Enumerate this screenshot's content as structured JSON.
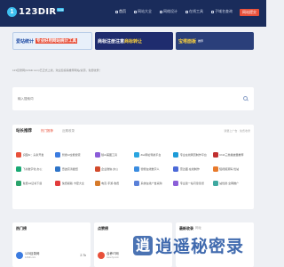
{
  "header": {
    "logo_mark": "1",
    "logo_text": "123DIR",
    "logo_sup": "beta",
    "nav": [
      {
        "label": "首页",
        "active": true
      },
      {
        "label": "网站大全",
        "active": false
      },
      {
        "label": "网络设计",
        "active": false
      },
      {
        "label": "在线工具",
        "active": false
      },
      {
        "label": "子域名查询",
        "active": false
      }
    ],
    "submit_label": "网站提交"
  },
  "banners": [
    {
      "text": "爱站统计",
      "highlight": "专业好用网站统计工具"
    },
    {
      "text": "商标注册注意",
      "highlight": "商标转让"
    },
    {
      "text": "宝塔面板",
      "sub": "推荐"
    }
  ],
  "notice": "123目录网(123dir.com)已正式上线，欢迎您投稿推荐网站/资源，免费收录！",
  "search": {
    "placeholder": "输入搜索词"
  },
  "recommend": {
    "title": "站长推荐",
    "tabs": [
      "热门推荐",
      "近期收录"
    ],
    "link": "我要上广告 · 免费收录",
    "items": [
      {
        "label": "识图AI：头条开发",
        "color": "#e8503a"
      },
      {
        "label": "智搜AI全能搜索",
        "color": "#3b7be0"
      },
      {
        "label": "随AI美图工具",
        "color": "#8a5cd8"
      },
      {
        "label": "Ziel网址导航平台",
        "color": "#2aa5e0"
      },
      {
        "label": "专业在线网页制作平台",
        "color": "#1d9bd8"
      },
      {
        "label": "CNA三类播放器推荐",
        "color": "#c03030"
      },
      {
        "label": "飞书数字化·办公",
        "color": "#19a974"
      },
      {
        "label": "奇迹高清壁纸",
        "color": "#2e74c8"
      },
      {
        "label": "企业微信·办公",
        "color": "#d24a2c"
      },
      {
        "label": "智能在线数字人",
        "color": "#3a8ce0"
      },
      {
        "label": "雷达图·在线制作",
        "color": "#4c6ad8"
      },
      {
        "label": "短视频源码·优站",
        "color": "#e87a2c"
      },
      {
        "label": "免费ssl证书下载",
        "color": "#2aa36b"
      },
      {
        "label": "免费模版·卡密大全",
        "color": "#e23c3c"
      },
      {
        "label": "电竞·手游·收费",
        "color": "#d67a2a"
      },
      {
        "label": "系统在线广告采购",
        "color": "#5a80d8"
      },
      {
        "label": "专业建一站可靠靠谱",
        "color": "#8b5fd8"
      },
      {
        "label": "站优搜·全网推广",
        "color": "#3fa8a0"
      }
    ]
  },
  "columns": [
    {
      "title": "热门榜",
      "tab": "",
      "row_name": "123目录网",
      "row_sub": "123dir.com",
      "count": "2.7k",
      "icon_color": "#3b7be0"
    },
    {
      "title": "点赞榜",
      "tab": "",
      "row_name": "合养IT网",
      "row_sub": "www.hy.com",
      "count": "",
      "icon_color": "#e8503a"
    },
    {
      "title": "最新收录",
      "tab": "网址",
      "row_name": "",
      "row_sub": "",
      "count": "",
      "icon_color": "#19a974"
    }
  ],
  "watermark": {
    "badge": "逍",
    "text": "逍遥秘密录"
  }
}
